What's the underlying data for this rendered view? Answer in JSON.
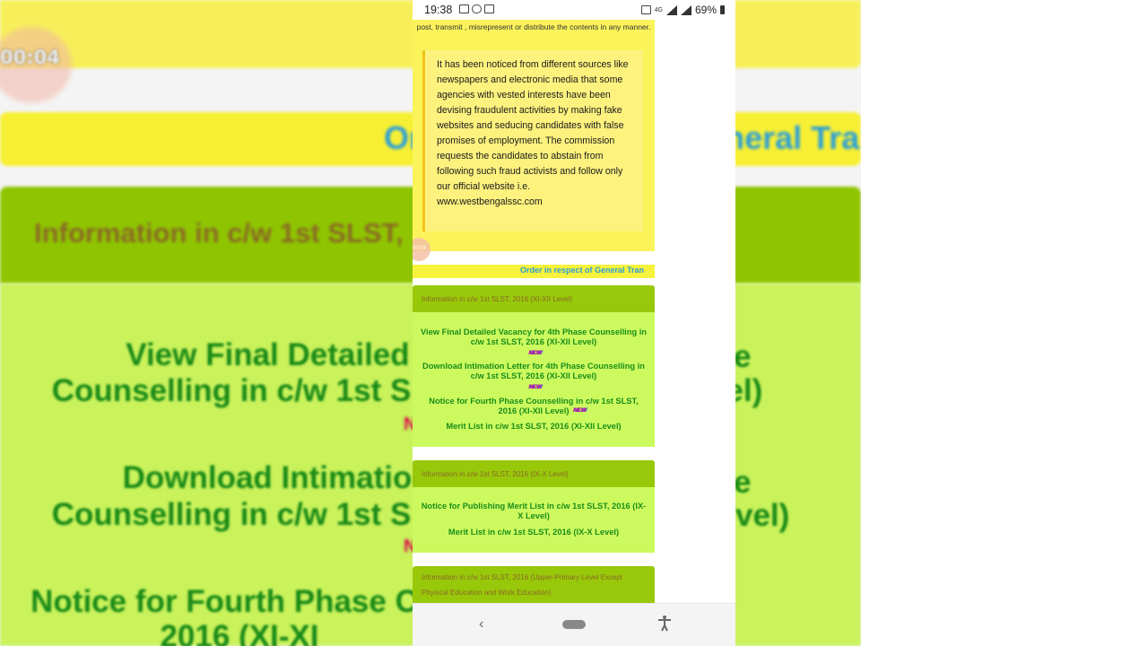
{
  "status_bar": {
    "time": "19:38",
    "network": "4G",
    "battery": "69%"
  },
  "notice": {
    "head": "post, transmit , misrepresent or distribute the contents in any manner.",
    "quote": "It has been noticed from different sources like newspapers and electronic media that some agencies with vested interests have been devising fraudulent activities by making fake websites and seducing candidates with false promises of employment. The commission requests the candidates to abstain from following such fraud activists and follow only our official website i.e. www.westbengalssc.com"
  },
  "marquee": "Order in respect of General Tran",
  "panels": [
    {
      "title": "Information in c/w 1st SLST, 2016 (XI-XII Level)",
      "links": [
        {
          "text": "View Final Detailed Vacancy for 4th Phase Counselling in c/w 1st SLST, 2016 (XI-XII Level)",
          "badge": "NEW"
        },
        {
          "text": "Download Intimation Letter for 4th Phase Counselling in c/w 1st SLST, 2016 (XI-XII Level)",
          "badge": "NEW"
        },
        {
          "text": "Notice for Fourth Phase Counselling in c/w 1st SLST, 2016 (XI-XII Level)",
          "badge": "NEW"
        },
        {
          "text": "Merit List in c/w 1st SLST, 2016 (XI-XII Level)",
          "badge": ""
        }
      ]
    },
    {
      "title": "Information in c/w 1st SLST, 2016 (IX-X Level)",
      "links": [
        {
          "text": "Notice for Publishing Merit List in c/w 1st SLST, 2016 (IX-X Level)",
          "badge": ""
        },
        {
          "text": "Merit List in c/w 1st SLST, 2016 (IX-X Level)",
          "badge": ""
        }
      ]
    },
    {
      "title": "Information in c/w 1st SLST, 2016 (Upper-Primary Level Except Physical Education and Work Education)",
      "links": []
    }
  ],
  "background": {
    "timer": "00:04",
    "marquee": "Order in respect of General Tran",
    "heading": "Information in c/w 1st SLST,",
    "line1a": "View Final Detailed V",
    "line1b": "Counselling in c/w 1st S",
    "line2a": "Download Intimatio",
    "line2b": "Counselling in c/w 1st S",
    "line3a": "Notice for Fourth Phase C",
    "line3b": "2016 (XI-XI"
  },
  "colors": {
    "notice_bg": "#fbf35a",
    "panel_head": "#98c80a",
    "panel_body": "#ccfa5e",
    "link": "#1a8d1a",
    "marquee_text": "#2d9fd6"
  },
  "icons": [
    "mail-icon",
    "cloud-icon",
    "translate-icon",
    "cast-icon",
    "signal-icon",
    "battery-icon",
    "back-icon",
    "home-icon",
    "accessibility-icon"
  ]
}
